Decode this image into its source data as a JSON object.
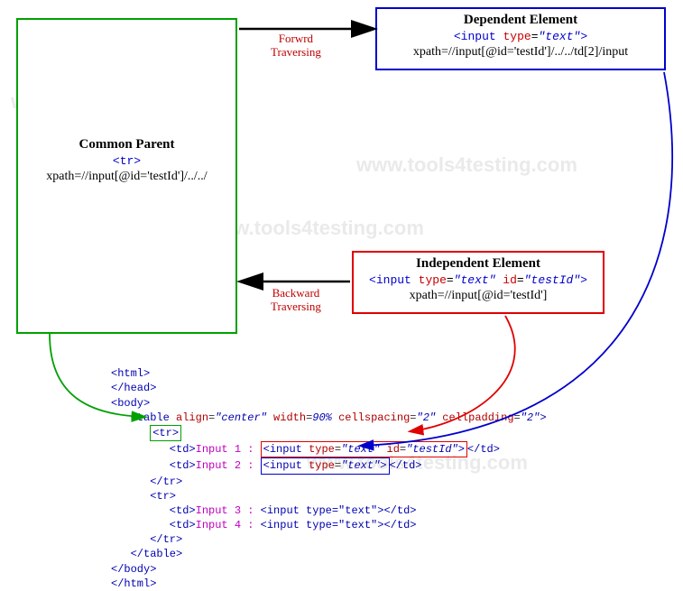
{
  "watermark": "www.tools4testing.com",
  "boxes": {
    "parent": {
      "title": "Common Parent",
      "code_html": "<tr>",
      "xpath": "xpath=//input[@id='testId']/../../"
    },
    "dependent": {
      "title": "Dependent Element",
      "code_tag": "<input",
      "code_attr": " type",
      "code_eq": "=",
      "code_val": "\"text\"",
      "code_close": ">",
      "xpath": "xpath=//input[@id='testId']/../../td[2]/input"
    },
    "independent": {
      "title": "Independent Element",
      "code_tag": "<input",
      "code_attr1": " type",
      "code_val1": "\"text\"",
      "code_attr2": " id",
      "code_val2": "\"testId\"",
      "code_close": ">",
      "xpath": "xpath=//input[@id='testId']"
    }
  },
  "labels": {
    "forward": "Forwrd\nTraversing",
    "backward": "Backward\nTraversing"
  },
  "code": {
    "l01": "<html>",
    "l02": "</head>",
    "l03": "<body>",
    "l04_pre": "   <table ",
    "l04_a1": "align",
    "l04_v1": "\"center\"",
    "l04_a2": " width",
    "l04_v2": "90%",
    "l04_a3": " cellspacing",
    "l04_v3": "\"2\"",
    "l04_a4": " cellpadding",
    "l04_v4": "\"2\"",
    "l04_close": ">",
    "l05": "<tr>",
    "l06_pre": "         <td>",
    "l06_txt": "Input 1 : ",
    "l06_in_tag": "<input ",
    "l06_in_a1": "type",
    "l06_in_v1": "\"text\"",
    "l06_in_a2": " id",
    "l06_in_v2": "\"testId\"",
    "l06_in_close": ">",
    "l06_post": "</td>",
    "l07_pre": "         <td>",
    "l07_txt": "Input 2 : ",
    "l07_in_tag": "<input ",
    "l07_in_a1": "type",
    "l07_in_v1": "\"text\"",
    "l07_in_close": ">",
    "l07_post": "</td>",
    "l08": "      </tr>",
    "l09": "      <tr>",
    "l10_pre": "         <td>",
    "l10_txt": "Input 3 : ",
    "l10_in": "<input type=\"text\">",
    "l10_post": "</td>",
    "l11_pre": "         <td>",
    "l11_txt": "Input 4 : ",
    "l11_in": "<input type=\"text\">",
    "l11_post": "</td>",
    "l12": "      </tr>",
    "l13": "   </table>",
    "l14": "</body>",
    "l15": "</html>"
  }
}
